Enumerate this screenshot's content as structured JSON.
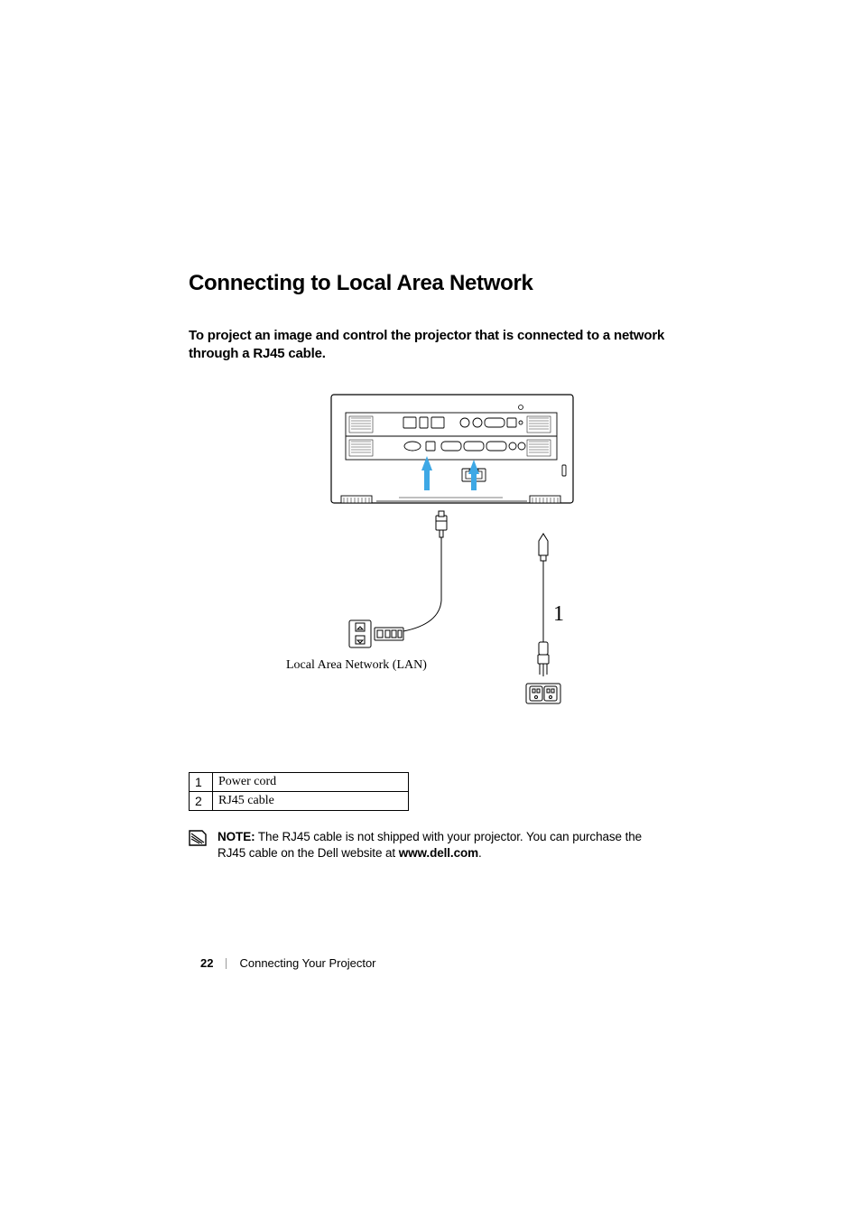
{
  "heading": "Connecting to Local Area Network",
  "sub_heading": "To project an image and control the projector that is connected to a network through a RJ45 cable.",
  "diagram": {
    "lan_label": "Local Area Network (LAN)",
    "callout_1": "1"
  },
  "legend": [
    {
      "num": "1",
      "desc": "Power cord"
    },
    {
      "num": "2",
      "desc": "RJ45 cable"
    }
  ],
  "note": {
    "label": "NOTE:",
    "text_before_link": " The RJ45 cable is not shipped with your projector. You can purchase the RJ45 cable on the Dell website at ",
    "link": "www.dell.com",
    "text_after_link": "."
  },
  "footer": {
    "page": "22",
    "section": "Connecting Your Projector"
  }
}
